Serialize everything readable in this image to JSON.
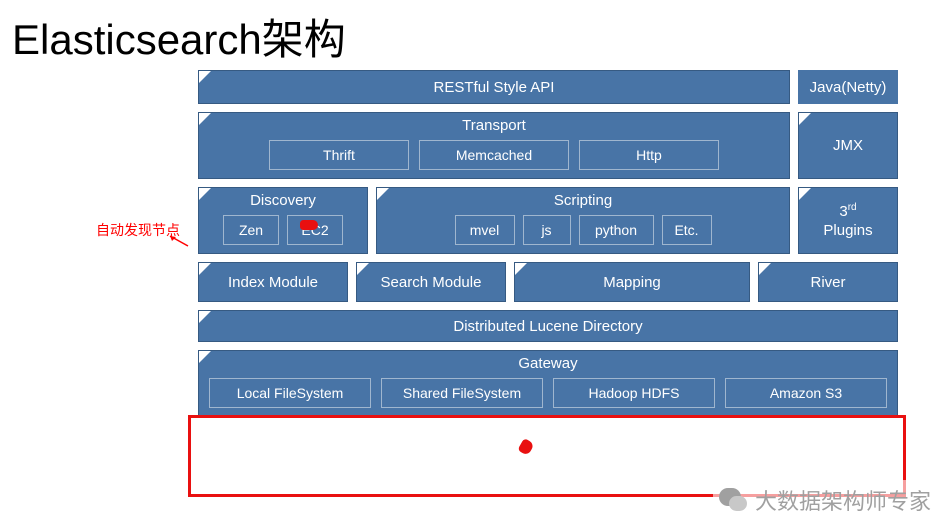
{
  "title": "Elasticsearch架构",
  "annotation": {
    "auto_discover": "自动发现节点"
  },
  "rows": {
    "r1": {
      "restful": "RESTful Style API",
      "java_netty": "Java(Netty)"
    },
    "r2": {
      "transport_label": "Transport",
      "thrift": "Thrift",
      "memcached": "Memcached",
      "http": "Http",
      "jmx": "JMX"
    },
    "r3": {
      "discovery_label": "Discovery",
      "zen": "Zen",
      "ec2": "EC2",
      "scripting_label": "Scripting",
      "mvel": "mvel",
      "js": "js",
      "python": "python",
      "etc": "Etc.",
      "plugins_prefix": "3",
      "plugins_suffix": "rd",
      "plugins_label": "Plugins"
    },
    "r4": {
      "index_module": "Index Module",
      "search_module": "Search Module",
      "mapping": "Mapping",
      "river": "River"
    },
    "r5": {
      "dld": "Distributed Lucene Directory"
    },
    "r6": {
      "gateway_label": "Gateway",
      "local_fs": "Local FileSystem",
      "shared_fs": "Shared FileSystem",
      "hadoop": "Hadoop HDFS",
      "s3": "Amazon S3"
    }
  },
  "overlay": {
    "wechat_text": "大数据架构师专家"
  }
}
